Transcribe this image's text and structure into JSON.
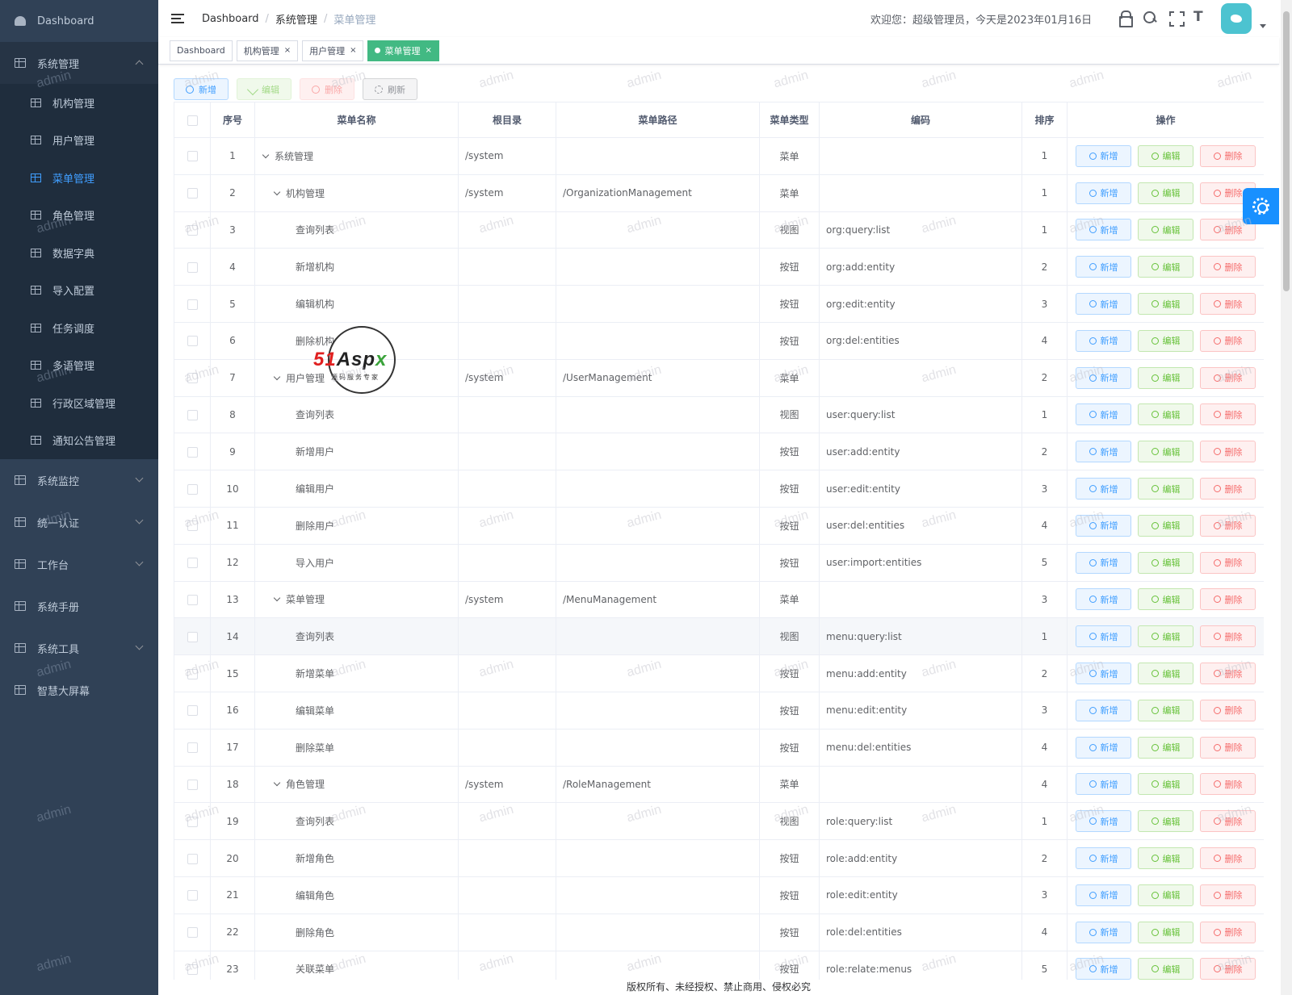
{
  "sidebar": {
    "dashboard": "Dashboard",
    "system_management": "系统管理",
    "sub_items": [
      "机构管理",
      "用户管理",
      "菜单管理",
      "角色管理",
      "数据字典",
      "导入配置",
      "任务调度",
      "多语管理",
      "行政区域管理",
      "通知公告管理"
    ],
    "active_sub_index": 2,
    "groups": [
      {
        "label": "系统监控",
        "has_arrow": true
      },
      {
        "label": "统一认证",
        "has_arrow": true
      },
      {
        "label": "工作台",
        "has_arrow": true
      },
      {
        "label": "系统手册",
        "has_arrow": false
      },
      {
        "label": "系统工具",
        "has_arrow": true
      },
      {
        "label": "智慧大屏幕",
        "has_arrow": false
      }
    ]
  },
  "header": {
    "breadcrumb": [
      "Dashboard",
      "系统管理",
      "菜单管理"
    ],
    "welcome": "欢迎您：超级管理员，今天是2023年01月16日",
    "size_icon_text": "T"
  },
  "tags": [
    {
      "label": "Dashboard",
      "closable": false,
      "active": false
    },
    {
      "label": "机构管理",
      "closable": true,
      "active": false
    },
    {
      "label": "用户管理",
      "closable": true,
      "active": false
    },
    {
      "label": "菜单管理",
      "closable": true,
      "active": true
    }
  ],
  "tag_close": "×",
  "toolbar": {
    "add": "新增",
    "edit": "编辑",
    "delete": "删除",
    "refresh": "刷新"
  },
  "table": {
    "columns": [
      "序号",
      "菜单名称",
      "根目录",
      "菜单路径",
      "菜单类型",
      "编码",
      "排序",
      "操作"
    ],
    "op_labels": {
      "add": "新增",
      "edit": "编辑",
      "delete": "删除"
    },
    "highlighted_row": 14,
    "rows": [
      {
        "no": "1",
        "name": "系统管理",
        "level": 0,
        "expand": true,
        "root": "/system",
        "path": "",
        "type": "菜单",
        "code": "",
        "sort": "1"
      },
      {
        "no": "2",
        "name": "机构管理",
        "level": 1,
        "expand": true,
        "root": "/system",
        "path": "/OrganizationManagement",
        "type": "菜单",
        "code": "",
        "sort": "1"
      },
      {
        "no": "3",
        "name": "查询列表",
        "level": 2,
        "expand": false,
        "root": "",
        "path": "",
        "type": "视图",
        "code": "org:query:list",
        "sort": "1"
      },
      {
        "no": "4",
        "name": "新增机构",
        "level": 2,
        "expand": false,
        "root": "",
        "path": "",
        "type": "按钮",
        "code": "org:add:entity",
        "sort": "2"
      },
      {
        "no": "5",
        "name": "编辑机构",
        "level": 2,
        "expand": false,
        "root": "",
        "path": "",
        "type": "按钮",
        "code": "org:edit:entity",
        "sort": "3"
      },
      {
        "no": "6",
        "name": "删除机构",
        "level": 2,
        "expand": false,
        "root": "",
        "path": "",
        "type": "按钮",
        "code": "org:del:entities",
        "sort": "4"
      },
      {
        "no": "7",
        "name": "用户管理",
        "level": 1,
        "expand": true,
        "root": "/system",
        "path": "/UserManagement",
        "type": "菜单",
        "code": "",
        "sort": "2"
      },
      {
        "no": "8",
        "name": "查询列表",
        "level": 2,
        "expand": false,
        "root": "",
        "path": "",
        "type": "视图",
        "code": "user:query:list",
        "sort": "1"
      },
      {
        "no": "9",
        "name": "新增用户",
        "level": 2,
        "expand": false,
        "root": "",
        "path": "",
        "type": "按钮",
        "code": "user:add:entity",
        "sort": "2"
      },
      {
        "no": "10",
        "name": "编辑用户",
        "level": 2,
        "expand": false,
        "root": "",
        "path": "",
        "type": "按钮",
        "code": "user:edit:entity",
        "sort": "3"
      },
      {
        "no": "11",
        "name": "删除用户",
        "level": 2,
        "expand": false,
        "root": "",
        "path": "",
        "type": "按钮",
        "code": "user:del:entities",
        "sort": "4"
      },
      {
        "no": "12",
        "name": "导入用户",
        "level": 2,
        "expand": false,
        "root": "",
        "path": "",
        "type": "按钮",
        "code": "user:import:entities",
        "sort": "5"
      },
      {
        "no": "13",
        "name": "菜单管理",
        "level": 1,
        "expand": true,
        "root": "/system",
        "path": "/MenuManagement",
        "type": "菜单",
        "code": "",
        "sort": "3"
      },
      {
        "no": "14",
        "name": "查询列表",
        "level": 2,
        "expand": false,
        "root": "",
        "path": "",
        "type": "视图",
        "code": "menu:query:list",
        "sort": "1"
      },
      {
        "no": "15",
        "name": "新增菜单",
        "level": 2,
        "expand": false,
        "root": "",
        "path": "",
        "type": "按钮",
        "code": "menu:add:entity",
        "sort": "2"
      },
      {
        "no": "16",
        "name": "编辑菜单",
        "level": 2,
        "expand": false,
        "root": "",
        "path": "",
        "type": "按钮",
        "code": "menu:edit:entity",
        "sort": "3"
      },
      {
        "no": "17",
        "name": "删除菜单",
        "level": 2,
        "expand": false,
        "root": "",
        "path": "",
        "type": "按钮",
        "code": "menu:del:entities",
        "sort": "4"
      },
      {
        "no": "18",
        "name": "角色管理",
        "level": 1,
        "expand": true,
        "root": "/system",
        "path": "/RoleManagement",
        "type": "菜单",
        "code": "",
        "sort": "4"
      },
      {
        "no": "19",
        "name": "查询列表",
        "level": 2,
        "expand": false,
        "root": "",
        "path": "",
        "type": "视图",
        "code": "role:query:list",
        "sort": "1"
      },
      {
        "no": "20",
        "name": "新增角色",
        "level": 2,
        "expand": false,
        "root": "",
        "path": "",
        "type": "按钮",
        "code": "role:add:entity",
        "sort": "2"
      },
      {
        "no": "21",
        "name": "编辑角色",
        "level": 2,
        "expand": false,
        "root": "",
        "path": "",
        "type": "按钮",
        "code": "role:edit:entity",
        "sort": "3"
      },
      {
        "no": "22",
        "name": "删除角色",
        "level": 2,
        "expand": false,
        "root": "",
        "path": "",
        "type": "按钮",
        "code": "role:del:entities",
        "sort": "4"
      },
      {
        "no": "23",
        "name": "关联菜单",
        "level": 2,
        "expand": false,
        "root": "",
        "path": "",
        "type": "按钮",
        "code": "role:relate:menus",
        "sort": "5"
      }
    ]
  },
  "footer": "版权所有、未经授权、禁止商用、侵权必究",
  "watermark": "admin",
  "logo": {
    "brand_a": "51",
    "brand_b": "Asp",
    "brand_c": "x",
    "slogan": "源码服务专家"
  },
  "colors": {
    "sidebar_bg": "#304156",
    "submenu_bg": "#1f2d3d",
    "active_menu": "#409eff",
    "active_tag": "#42b983"
  }
}
